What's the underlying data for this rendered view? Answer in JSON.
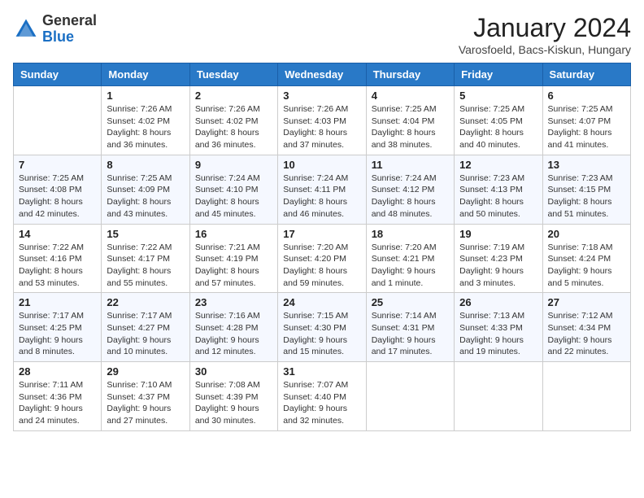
{
  "logo": {
    "general": "General",
    "blue": "Blue"
  },
  "title": "January 2024",
  "subtitle": "Varosfoeld, Bacs-Kiskun, Hungary",
  "days_header": [
    "Sunday",
    "Monday",
    "Tuesday",
    "Wednesday",
    "Thursday",
    "Friday",
    "Saturday"
  ],
  "weeks": [
    [
      {
        "day": "",
        "info": ""
      },
      {
        "day": "1",
        "info": "Sunrise: 7:26 AM\nSunset: 4:02 PM\nDaylight: 8 hours\nand 36 minutes."
      },
      {
        "day": "2",
        "info": "Sunrise: 7:26 AM\nSunset: 4:02 PM\nDaylight: 8 hours\nand 36 minutes."
      },
      {
        "day": "3",
        "info": "Sunrise: 7:26 AM\nSunset: 4:03 PM\nDaylight: 8 hours\nand 37 minutes."
      },
      {
        "day": "4",
        "info": "Sunrise: 7:25 AM\nSunset: 4:04 PM\nDaylight: 8 hours\nand 38 minutes."
      },
      {
        "day": "5",
        "info": "Sunrise: 7:25 AM\nSunset: 4:05 PM\nDaylight: 8 hours\nand 40 minutes."
      },
      {
        "day": "6",
        "info": "Sunrise: 7:25 AM\nSunset: 4:07 PM\nDaylight: 8 hours\nand 41 minutes."
      }
    ],
    [
      {
        "day": "7",
        "info": "Sunrise: 7:25 AM\nSunset: 4:08 PM\nDaylight: 8 hours\nand 42 minutes."
      },
      {
        "day": "8",
        "info": "Sunrise: 7:25 AM\nSunset: 4:09 PM\nDaylight: 8 hours\nand 43 minutes."
      },
      {
        "day": "9",
        "info": "Sunrise: 7:24 AM\nSunset: 4:10 PM\nDaylight: 8 hours\nand 45 minutes."
      },
      {
        "day": "10",
        "info": "Sunrise: 7:24 AM\nSunset: 4:11 PM\nDaylight: 8 hours\nand 46 minutes."
      },
      {
        "day": "11",
        "info": "Sunrise: 7:24 AM\nSunset: 4:12 PM\nDaylight: 8 hours\nand 48 minutes."
      },
      {
        "day": "12",
        "info": "Sunrise: 7:23 AM\nSunset: 4:13 PM\nDaylight: 8 hours\nand 50 minutes."
      },
      {
        "day": "13",
        "info": "Sunrise: 7:23 AM\nSunset: 4:15 PM\nDaylight: 8 hours\nand 51 minutes."
      }
    ],
    [
      {
        "day": "14",
        "info": "Sunrise: 7:22 AM\nSunset: 4:16 PM\nDaylight: 8 hours\nand 53 minutes."
      },
      {
        "day": "15",
        "info": "Sunrise: 7:22 AM\nSunset: 4:17 PM\nDaylight: 8 hours\nand 55 minutes."
      },
      {
        "day": "16",
        "info": "Sunrise: 7:21 AM\nSunset: 4:19 PM\nDaylight: 8 hours\nand 57 minutes."
      },
      {
        "day": "17",
        "info": "Sunrise: 7:20 AM\nSunset: 4:20 PM\nDaylight: 8 hours\nand 59 minutes."
      },
      {
        "day": "18",
        "info": "Sunrise: 7:20 AM\nSunset: 4:21 PM\nDaylight: 9 hours\nand 1 minute."
      },
      {
        "day": "19",
        "info": "Sunrise: 7:19 AM\nSunset: 4:23 PM\nDaylight: 9 hours\nand 3 minutes."
      },
      {
        "day": "20",
        "info": "Sunrise: 7:18 AM\nSunset: 4:24 PM\nDaylight: 9 hours\nand 5 minutes."
      }
    ],
    [
      {
        "day": "21",
        "info": "Sunrise: 7:17 AM\nSunset: 4:25 PM\nDaylight: 9 hours\nand 8 minutes."
      },
      {
        "day": "22",
        "info": "Sunrise: 7:17 AM\nSunset: 4:27 PM\nDaylight: 9 hours\nand 10 minutes."
      },
      {
        "day": "23",
        "info": "Sunrise: 7:16 AM\nSunset: 4:28 PM\nDaylight: 9 hours\nand 12 minutes."
      },
      {
        "day": "24",
        "info": "Sunrise: 7:15 AM\nSunset: 4:30 PM\nDaylight: 9 hours\nand 15 minutes."
      },
      {
        "day": "25",
        "info": "Sunrise: 7:14 AM\nSunset: 4:31 PM\nDaylight: 9 hours\nand 17 minutes."
      },
      {
        "day": "26",
        "info": "Sunrise: 7:13 AM\nSunset: 4:33 PM\nDaylight: 9 hours\nand 19 minutes."
      },
      {
        "day": "27",
        "info": "Sunrise: 7:12 AM\nSunset: 4:34 PM\nDaylight: 9 hours\nand 22 minutes."
      }
    ],
    [
      {
        "day": "28",
        "info": "Sunrise: 7:11 AM\nSunset: 4:36 PM\nDaylight: 9 hours\nand 24 minutes."
      },
      {
        "day": "29",
        "info": "Sunrise: 7:10 AM\nSunset: 4:37 PM\nDaylight: 9 hours\nand 27 minutes."
      },
      {
        "day": "30",
        "info": "Sunrise: 7:08 AM\nSunset: 4:39 PM\nDaylight: 9 hours\nand 30 minutes."
      },
      {
        "day": "31",
        "info": "Sunrise: 7:07 AM\nSunset: 4:40 PM\nDaylight: 9 hours\nand 32 minutes."
      },
      {
        "day": "",
        "info": ""
      },
      {
        "day": "",
        "info": ""
      },
      {
        "day": "",
        "info": ""
      }
    ]
  ]
}
